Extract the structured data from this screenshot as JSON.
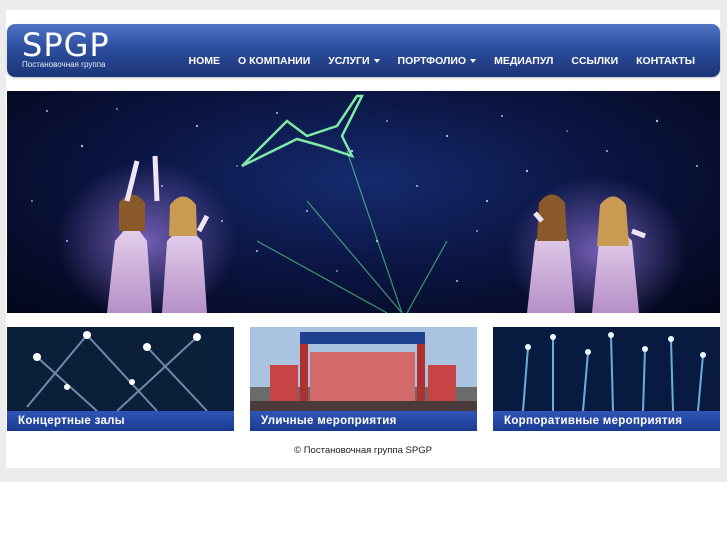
{
  "header": {
    "logo_title": "SPGP",
    "logo_subtitle": "Постановочная группа",
    "nav": [
      {
        "label": "HOME",
        "dropdown": false
      },
      {
        "label": "О КОМПАНИИ",
        "dropdown": false
      },
      {
        "label": "УСЛУГИ",
        "dropdown": true
      },
      {
        "label": "ПОРТФОЛИО",
        "dropdown": true
      },
      {
        "label": "МЕДИАПУЛ",
        "dropdown": false
      },
      {
        "label": "ССЫЛКИ",
        "dropdown": false
      },
      {
        "label": "КОНТАКТЫ",
        "dropdown": false
      }
    ]
  },
  "hero": {
    "image": "stage-performers-laser-bird-image"
  },
  "cards": [
    {
      "label": "Концертные залы",
      "image": "concert-hall-lights-image"
    },
    {
      "label": "Уличные мероприятия",
      "image": "street-event-stage-image"
    },
    {
      "label": "Корпоративные мероприятия",
      "image": "corporate-fountain-image"
    }
  ],
  "footer": {
    "copyright": "© Постановочная группа SPGP"
  },
  "colors": {
    "header_top": "#4f73c2",
    "header_bottom": "#1b3477",
    "card_label": "#1b3a8f",
    "page_band": "#ececec"
  }
}
